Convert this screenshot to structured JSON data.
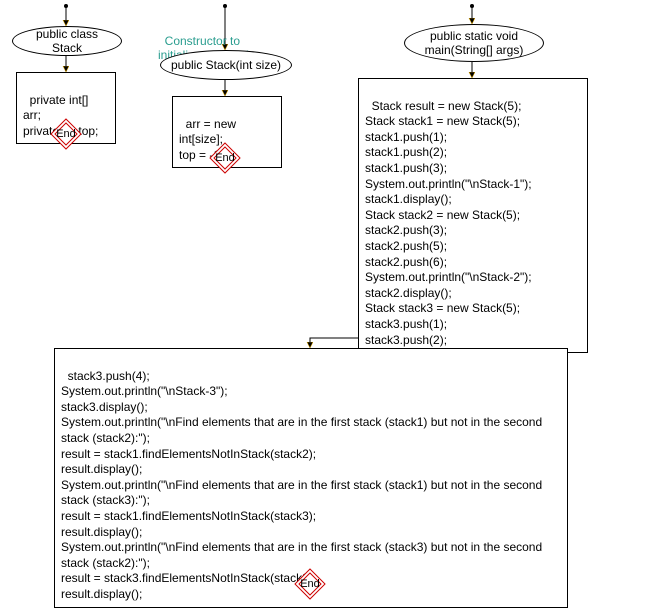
{
  "chart_data": {
    "type": "flowchart",
    "nodes": [
      {
        "id": "classStack",
        "shape": "ellipse",
        "text": "public class Stack"
      },
      {
        "id": "fields",
        "shape": "rect",
        "text": "private int[] arr;\nprivate int top;"
      },
      {
        "id": "end1",
        "shape": "end",
        "text": "End"
      },
      {
        "id": "constructorComment",
        "shape": "comment",
        "text": "Constructor to\ninitialize the stack"
      },
      {
        "id": "constructor",
        "shape": "ellipse",
        "text": "public Stack(int size)"
      },
      {
        "id": "constructorBody",
        "shape": "rect",
        "text": "arr = new int[size];\ntop = -1;"
      },
      {
        "id": "end2",
        "shape": "end",
        "text": "End"
      },
      {
        "id": "mainSig",
        "shape": "ellipse",
        "text": "public static void\nmain(String[] args)"
      },
      {
        "id": "mainBody1",
        "shape": "rect",
        "text": "Stack result = new Stack(5);\nStack stack1 = new Stack(5);\nstack1.push(1);\nstack1.push(2);\nstack1.push(3);\nSystem.out.println(\"\\nStack-1\");\nstack1.display();\nStack stack2 = new Stack(5);\nstack2.push(3);\nstack2.push(5);\nstack2.push(6);\nSystem.out.println(\"\\nStack-2\");\nstack2.display();\nStack stack3 = new Stack(5);\nstack3.push(1);\nstack3.push(2);"
      },
      {
        "id": "mainBody2",
        "shape": "rect",
        "text": "stack3.push(4);\nSystem.out.println(\"\\nStack-3\");\nstack3.display();\nSystem.out.println(\"\\nFind elements that are in the first stack (stack1) but not in the second\nstack (stack2):\");\nresult = stack1.findElementsNotInStack(stack2);\nresult.display();\nSystem.out.println(\"\\nFind elements that are in the first stack (stack1) but not in the second\nstack (stack3):\");\nresult = stack1.findElementsNotInStack(stack3);\nresult.display();\nSystem.out.println(\"\\nFind elements that are in the first stack (stack3) but not in the second\nstack (stack2):\");\nresult = stack3.findElementsNotInStack(stack2);\nresult.display();"
      },
      {
        "id": "end3",
        "shape": "end",
        "text": "End"
      }
    ],
    "edges": [
      [
        "entry1",
        "classStack"
      ],
      [
        "classStack",
        "fields"
      ],
      [
        "fields",
        "end1"
      ],
      [
        "entry2",
        "constructor"
      ],
      [
        "constructor",
        "constructorBody"
      ],
      [
        "constructorBody",
        "end2"
      ],
      [
        "entry3",
        "mainSig"
      ],
      [
        "mainSig",
        "mainBody1"
      ],
      [
        "mainBody1",
        "mainBody2"
      ],
      [
        "mainBody2",
        "end3"
      ]
    ]
  },
  "nodes": {
    "classStack": "public class Stack",
    "fields": "private int[] arr;\nprivate int top;",
    "end1": "End",
    "constructorComment": "Constructor to\ninitialize the stack",
    "constructor": "public Stack(int size)",
    "constructorBody": "arr = new int[size];\ntop = -1;",
    "end2": "End",
    "mainSig": "public static void\nmain(String[] args)",
    "mainBody1": "Stack result = new Stack(5);\nStack stack1 = new Stack(5);\nstack1.push(1);\nstack1.push(2);\nstack1.push(3);\nSystem.out.println(\"\\nStack-1\");\nstack1.display();\nStack stack2 = new Stack(5);\nstack2.push(3);\nstack2.push(5);\nstack2.push(6);\nSystem.out.println(\"\\nStack-2\");\nstack2.display();\nStack stack3 = new Stack(5);\nstack3.push(1);\nstack3.push(2);",
    "mainBody2": "stack3.push(4);\nSystem.out.println(\"\\nStack-3\");\nstack3.display();\nSystem.out.println(\"\\nFind elements that are in the first stack (stack1) but not in the second\nstack (stack2):\");\nresult = stack1.findElementsNotInStack(stack2);\nresult.display();\nSystem.out.println(\"\\nFind elements that are in the first stack (stack1) but not in the second\nstack (stack3):\");\nresult = stack1.findElementsNotInStack(stack3);\nresult.display();\nSystem.out.println(\"\\nFind elements that are in the first stack (stack3) but not in the second\nstack (stack2):\");\nresult = stack3.findElementsNotInStack(stack2);\nresult.display();",
    "end3": "End"
  }
}
